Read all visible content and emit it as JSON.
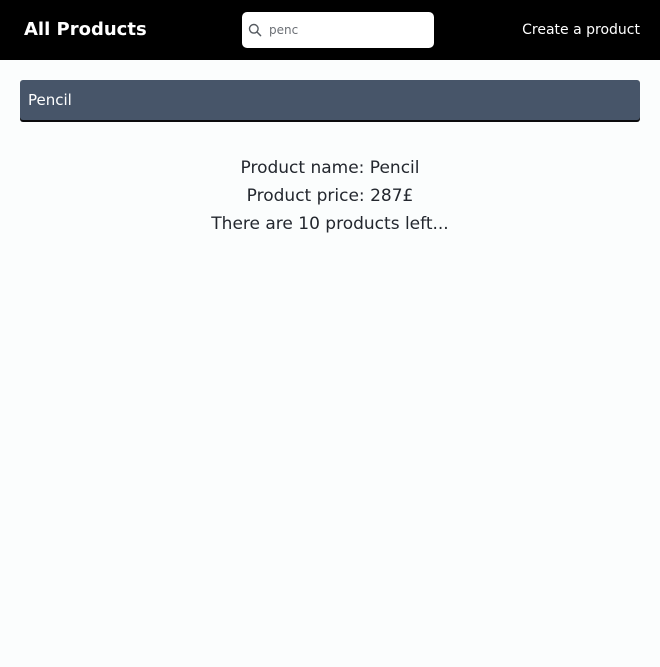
{
  "header": {
    "title": "All Products",
    "search": {
      "value": "penc",
      "icon": "search-icon"
    },
    "create_link": "Create a product"
  },
  "results": [
    {
      "label": "Pencil"
    }
  ],
  "details": {
    "name_line": "Product name: Pencil",
    "price_line": "Product price: 287£",
    "stock_line": "There are 10 products left..."
  },
  "colors": {
    "header_bg": "#000000",
    "result_bg": "#475569",
    "page_bg": "#fbfdfd",
    "text": "#23272e"
  }
}
